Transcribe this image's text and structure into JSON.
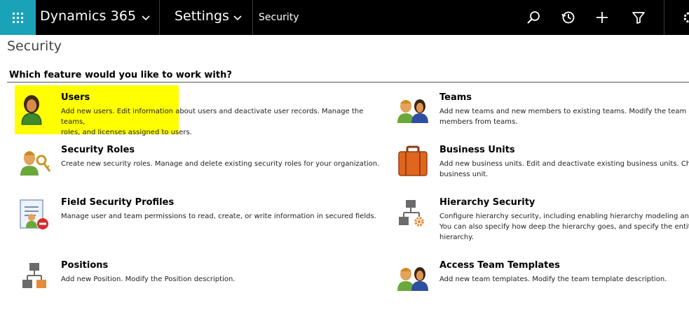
{
  "nav": {
    "app_name": "Dynamics 365",
    "area": "Settings",
    "breadcrumb": "Security",
    "icons": [
      "app-launcher-icon",
      "search-icon",
      "recent-icon",
      "new-icon",
      "filter-icon",
      "settings-icon"
    ]
  },
  "page": {
    "title": "Security",
    "question": "Which feature would you like to work with?",
    "highlight_color": "#ffff00"
  },
  "features": {
    "users": {
      "title": "Users",
      "line1": "Add new users. Edit information about users and deactivate user records. Manage the teams,",
      "line2": "roles, and licenses assigned to users."
    },
    "teams": {
      "title": "Teams",
      "line1": "Add new teams and new members to existing teams. Modify the team des",
      "line2": "members from teams."
    },
    "security_roles": {
      "title": "Security Roles",
      "line1": "Create new security roles. Manage and delete existing security roles for your organization."
    },
    "business_units": {
      "title": "Business Units",
      "line1": "Add new business units. Edit and deactivate existing business units. Chang",
      "line2": "business unit."
    },
    "field_security_profiles": {
      "title": "Field Security Profiles",
      "line1": "Manage user and team permissions to read, create, or write information in secured fields."
    },
    "hierarchy_security": {
      "title": "Hierarchy Security",
      "line1": "Configure hierarchy security, including enabling hierarchy modeling and s",
      "line2": "You can also specify how deep the hierarchy goes, and specify the entities",
      "line3": "hierarchy."
    },
    "positions": {
      "title": "Positions",
      "line1": "Add new Position. Modify the Position description."
    },
    "access_team_templates": {
      "title": "Access Team Templates",
      "line1": "Add new team templates. Modify the team template description."
    }
  }
}
